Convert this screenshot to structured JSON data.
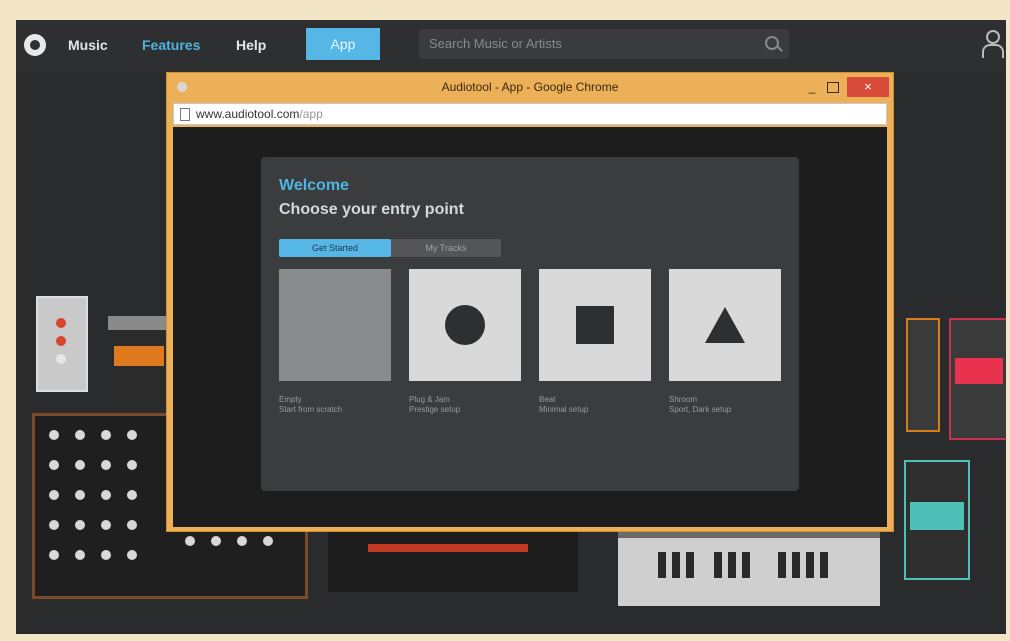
{
  "topnav": {
    "logo": "logo-icon",
    "links": [
      "Music",
      "Features",
      "Help"
    ],
    "app_button": "App",
    "search_placeholder": "Search Music or Artists",
    "user_icon": "user-icon"
  },
  "chrome": {
    "title": "Audiotool - App - Google Chrome",
    "minimize": "_",
    "close": "×",
    "url_host": "www.audiotool.com",
    "url_path": "/app"
  },
  "welcome": {
    "title": "Welcome",
    "subtitle": "Choose your entry point",
    "tabs": [
      "Get Started",
      "My Tracks"
    ],
    "cards": [
      {
        "line1": "Empty",
        "line2": "Start from scratch"
      },
      {
        "line1": "Plug & Jam",
        "line2": "Prestige setup"
      },
      {
        "line1": "Beat",
        "line2": "Minimal setup"
      },
      {
        "line1": "Shroom",
        "line2": "Sport, Dark setup"
      }
    ]
  },
  "colors": {
    "accent_blue": "#56b6e6",
    "chrome_frame": "#ecb058",
    "close_red": "#d84a3a"
  }
}
